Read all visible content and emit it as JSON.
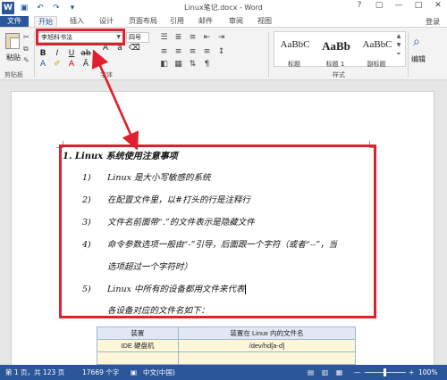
{
  "window": {
    "title": "Linux笔记.docx - Word",
    "controls": [
      "?",
      "▢",
      "—",
      "□",
      "✕"
    ]
  },
  "tabs": {
    "file": "文件",
    "items": [
      "开始",
      "插入",
      "设计",
      "页面布局",
      "引用",
      "邮件",
      "审阅",
      "视图"
    ],
    "login": "登录"
  },
  "ribbon": {
    "clipboard": {
      "paste": "粘贴",
      "group_label": "剪贴板"
    },
    "font": {
      "name": "李旭科书法",
      "size": "四号",
      "group_label": "字体"
    },
    "styles": {
      "group_label": "样式",
      "items": [
        {
          "sample": "AaBbC",
          "name": "标题"
        },
        {
          "sample": "AaBb",
          "name": "标题 1"
        },
        {
          "sample": "AaBbC",
          "name": "副标题"
        }
      ]
    },
    "editing": {
      "label": "编辑"
    }
  },
  "document": {
    "title": "1. Linux 系统使用注意事项",
    "items": [
      {
        "num": "1)",
        "text": "Linux 是大小写敏感的系统"
      },
      {
        "num": "2)",
        "text": "在配置文件里，以#打头的行是注释行"
      },
      {
        "num": "3)",
        "text": "文件名前面带“.”的文件表示是隐藏文件"
      },
      {
        "num": "4)",
        "text": "命令参数选项一般由“-”引导，后面跟一个字符（或者“--”，当"
      },
      {
        "num": "",
        "text": "选项超过一个字符时）"
      },
      {
        "num": "5)",
        "text": "Linux 中所有的设备都用文件来代表"
      },
      {
        "num": "",
        "text": "各设备对应的文件名如下："
      }
    ],
    "table": {
      "headers": [
        "装置",
        "装置在 Linux 内的文件名"
      ],
      "rows": [
        [
          "IDE 硬盘机",
          "/dev/hd[a-d]"
        ],
        [
          "",
          ""
        ]
      ]
    }
  },
  "status": {
    "page": "第 1 页，共 123 页",
    "words": "17669 个字",
    "lang": "中文(中国)",
    "zoom": "100%",
    "zoom_minus": "—",
    "zoom_plus": "+"
  },
  "colors": {
    "accent": "#2b579a",
    "highlight": "#e0202e"
  }
}
